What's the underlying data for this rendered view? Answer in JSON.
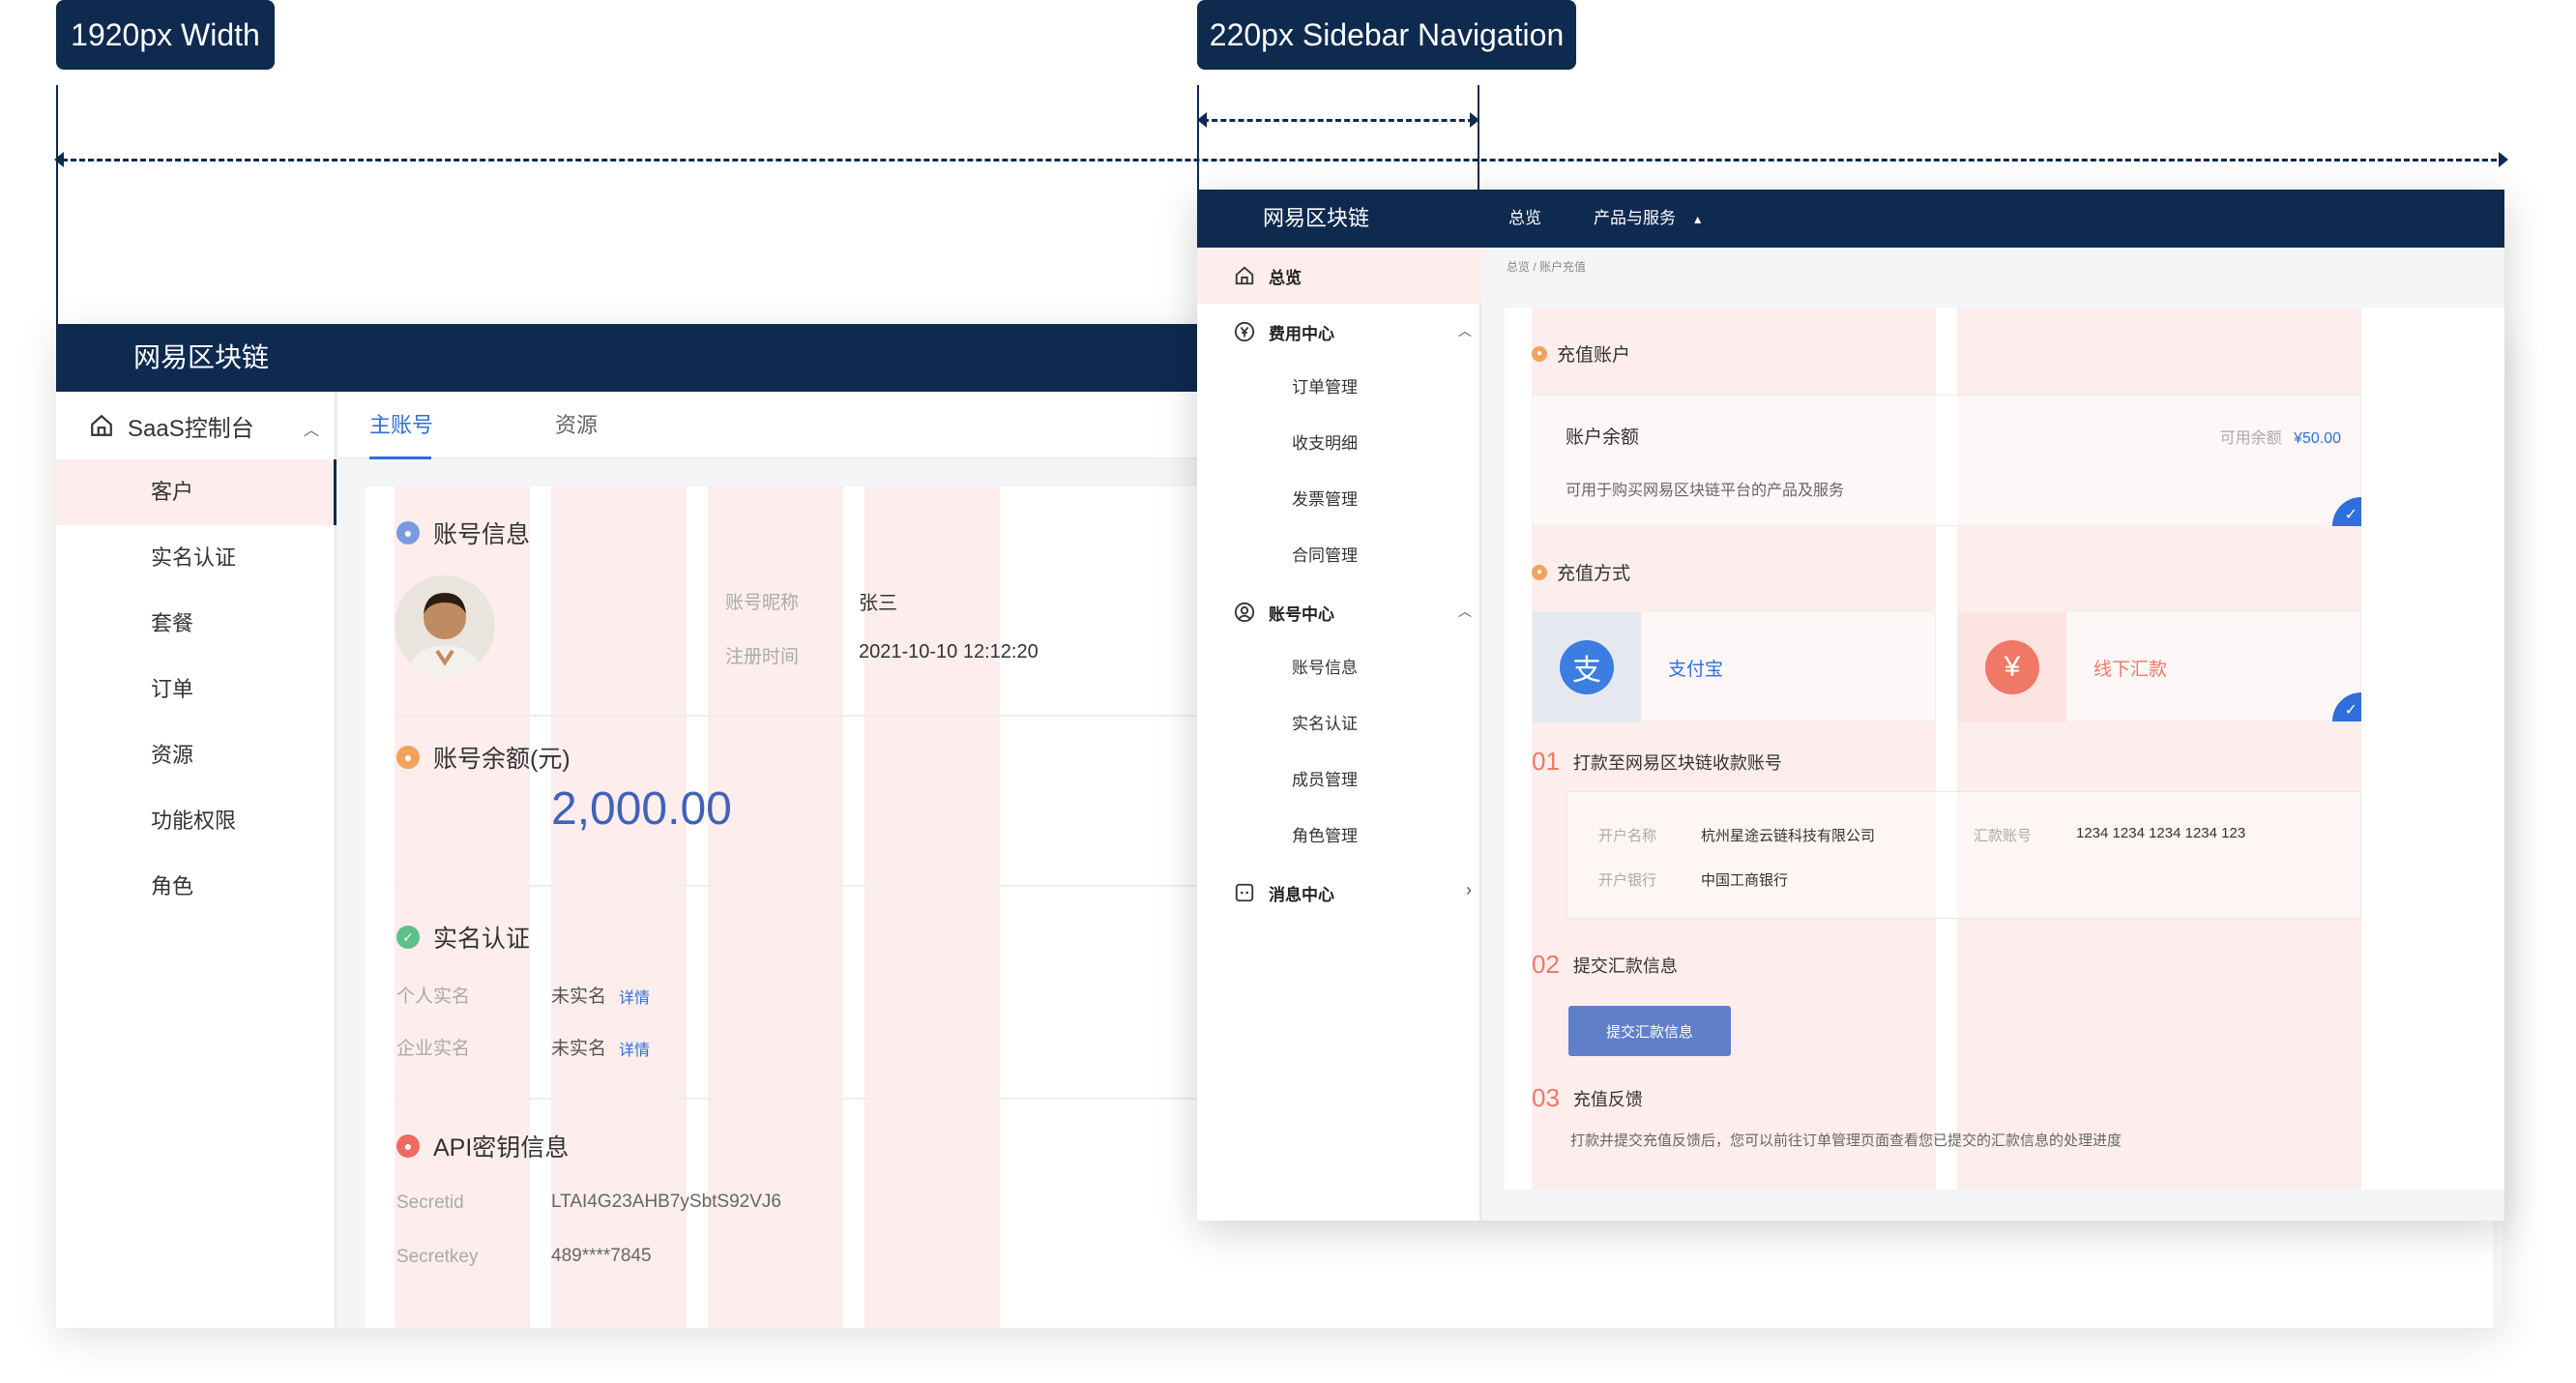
{
  "annotations": {
    "width_label": "1920px Width",
    "sidebar_label": "220px Sidebar Navigation"
  },
  "screen_a": {
    "brand": "网易区块链",
    "sidebar": {
      "header": "SaaS控制台",
      "items": [
        {
          "label": "客户",
          "active": true
        },
        {
          "label": "实名认证"
        },
        {
          "label": "套餐"
        },
        {
          "label": "订单"
        },
        {
          "label": "资源"
        },
        {
          "label": "功能权限"
        },
        {
          "label": "角色"
        }
      ]
    },
    "tabs": [
      {
        "label": "主账号",
        "active": true
      },
      {
        "label": "资源"
      }
    ],
    "account_info": {
      "title": "账号信息",
      "nickname_label": "账号昵称",
      "nickname": "张三",
      "register_label": "注册时间",
      "register_time": "2021-10-10 12:12:20"
    },
    "balance": {
      "title": "账号余额(元)",
      "value": "2,000.00"
    },
    "realname": {
      "title": "实名认证",
      "personal_label": "个人实名",
      "personal_value": "未实名",
      "personal_link": "详情",
      "company_label": "企业实名",
      "company_value": "未实名",
      "company_link": "详情"
    },
    "api": {
      "title": "API密钥信息",
      "secretid_label": "Secretid",
      "secretid": "LTAI4G23AHB7ySbtS92VJ6",
      "secretkey_label": "Secretkey",
      "secretkey": "489****7845"
    }
  },
  "screen_b": {
    "brand": "网易区块链",
    "nav": {
      "overview": "总览",
      "products": "产品与服务",
      "products_caret": "▲"
    },
    "sidebar": {
      "overview": "总览",
      "groups": [
        {
          "label": "费用中心",
          "children": [
            "订单管理",
            "收支明细",
            "发票管理",
            "合同管理"
          ]
        },
        {
          "label": "账号中心",
          "children": [
            "账号信息",
            "实名认证",
            "成员管理",
            "角色管理"
          ]
        },
        {
          "label": "消息中心",
          "children": []
        }
      ]
    },
    "breadcrumb": "总览 / 账户充值",
    "recharge_account": {
      "title": "充值账户",
      "balance_label": "账户余额",
      "available_label": "可用余额",
      "available_value": "¥50.00",
      "desc": "可用于购买网易区块链平台的产品及服务"
    },
    "methods": {
      "title": "充值方式",
      "alipay": "支付宝",
      "alipay_icon": "支",
      "offline": "线下汇款",
      "offline_icon": "¥"
    },
    "steps": [
      {
        "num": "01",
        "title": "打款至网易区块链收款账号"
      },
      {
        "num": "02",
        "title": "提交汇款信息"
      },
      {
        "num": "03",
        "title": "充值反馈"
      }
    ],
    "bank": {
      "name_label": "开户名称",
      "name": "杭州星途云链科技有限公司",
      "account_label": "汇款账号",
      "account": "1234 1234 1234 1234 123",
      "bank_label": "开户银行",
      "bank": "中国工商银行"
    },
    "submit_button": "提交汇款信息",
    "feedback_text": "打款并提交充值反馈后，您可以前往订单管理页面查看您已提交的汇款信息的处理进度"
  }
}
